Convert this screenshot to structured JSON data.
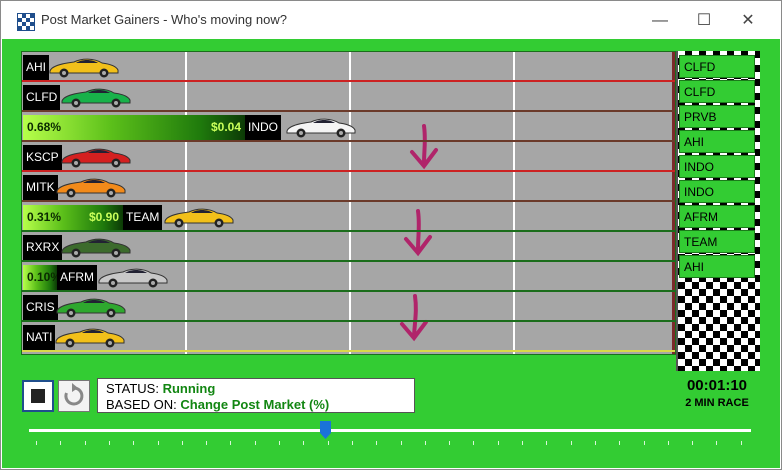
{
  "window": {
    "title": "Post Market Gainers - Who's moving now?",
    "minimize": "—",
    "maximize": "☐",
    "close": "✕"
  },
  "lanes": [
    {
      "ticker": "AHI",
      "car_color": "#f2c01a",
      "border_color": "#cc2222"
    },
    {
      "ticker": "CLFD",
      "car_color": "#18b24a",
      "border_color": "#6b3a2a"
    },
    {
      "ticker": "INDO",
      "pct": "0.68%",
      "amount": "$0.04",
      "car_color": "#f4f4f4",
      "border_color": "#6b3a2a"
    },
    {
      "ticker": "KSCP",
      "car_color": "#d42020",
      "border_color": "#cc2222"
    },
    {
      "ticker": "MITK",
      "car_color": "#f28a1a",
      "border_color": "#6b3a2a"
    },
    {
      "ticker": "TEAM",
      "pct": "0.31%",
      "amount": "$0.90",
      "car_color": "#f2c01a",
      "border_color": "#1b6d1b"
    },
    {
      "ticker": "RXRX",
      "car_color": "#3c6b2c",
      "border_color": "#1b6d1b"
    },
    {
      "ticker": "AFRM",
      "pct": "0.10%",
      "amount": "",
      "car_color": "#c8c8c8",
      "border_color": "#1b6d1b"
    },
    {
      "ticker": "CRIS",
      "car_color": "#2ea82e",
      "border_color": "#1b6d1b"
    },
    {
      "ticker": "NATI",
      "car_color": "#f2c01a",
      "border_color": "#d8d84a"
    }
  ],
  "leaderboard": [
    "CLFD",
    "CLFD",
    "PRVB",
    "AHI",
    "INDO",
    "INDO",
    "AFRM",
    "TEAM",
    "AHI"
  ],
  "status": {
    "status_label": "STATUS:",
    "status_value": "Running",
    "based_label": "BASED ON:",
    "based_value": "Change Post Market (%)"
  },
  "timer": "00:01:10",
  "race_length": "2 MIN RACE",
  "slider": {
    "position": 0.41
  },
  "colors": {
    "background": "#33cc33",
    "track": "#a6a6a6",
    "arrow": "#b0246a"
  },
  "icons": {
    "stop": "stop-icon",
    "reset": "refresh-icon",
    "app": "checkered-flag-icon"
  }
}
